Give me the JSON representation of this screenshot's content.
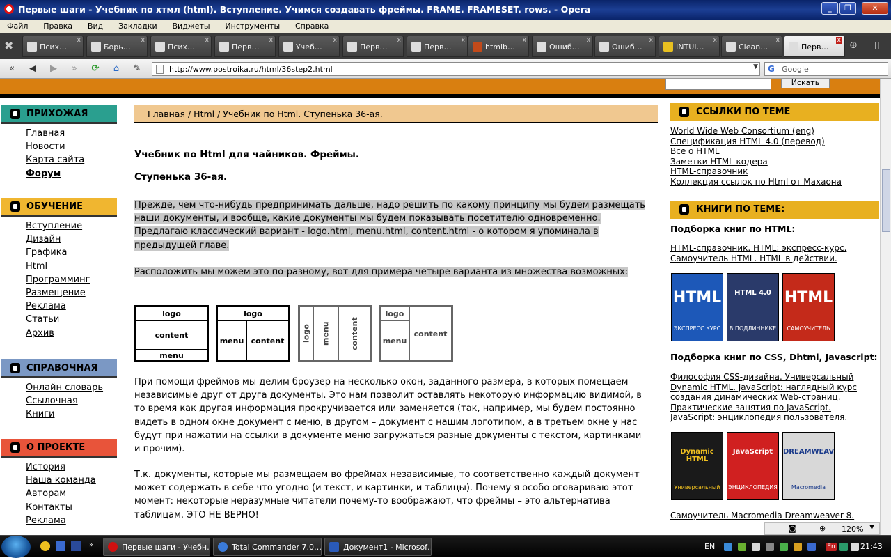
{
  "window": {
    "title": "Первые шаги - Учебник по хтмл (html). Вступление. Учимся создавать фреймы. FRAME. FRAMESET. rows. - Opera",
    "min": "_",
    "max": "❐",
    "close": "✕"
  },
  "menubar": [
    "Файл",
    "Правка",
    "Вид",
    "Закладки",
    "Виджеты",
    "Инструменты",
    "Справка"
  ],
  "tabs": [
    {
      "label": "Псих…",
      "close": "x"
    },
    {
      "label": "Борь…",
      "close": "x"
    },
    {
      "label": "Псих…",
      "close": "x"
    },
    {
      "label": "Перв…",
      "close": "x"
    },
    {
      "label": "Учеб…",
      "close": "x"
    },
    {
      "label": "Перв…",
      "close": "x"
    },
    {
      "label": "Перв…",
      "close": "x"
    },
    {
      "label": "htmlb…",
      "close": "x"
    },
    {
      "label": "Ошиб…",
      "close": "x"
    },
    {
      "label": "Ошиб…",
      "close": "x"
    },
    {
      "label": "INTUI…",
      "close": "x"
    },
    {
      "label": "Clean…",
      "close": "x"
    },
    {
      "label": "Перв…",
      "close": "x"
    }
  ],
  "address": {
    "url": "http://www.postroika.ru/html/36step2.html",
    "search_placeholder": "Google",
    "search_logo": "G"
  },
  "site": {
    "search_button": "Искать"
  },
  "sidebar": {
    "sections": [
      {
        "title": "ПРИХОЖАЯ",
        "color": "#2a9f8f",
        "items": [
          "Главная",
          "Новости",
          "Карта сайта",
          "Форум"
        ]
      },
      {
        "title": "ОБУЧЕНИЕ",
        "color": "#f0b630",
        "items": [
          "Вступление",
          "Дизайн",
          "Графика",
          "Html",
          "Программинг",
          "Размещение",
          "Реклама",
          "Статьи",
          "Архив"
        ]
      },
      {
        "title": "СПРАВОЧНАЯ",
        "color": "#7b98c4",
        "items": [
          "Онлайн словарь",
          "Ссылочная",
          "Книги"
        ]
      },
      {
        "title": "О ПРОЕКТЕ",
        "color": "#e8543a",
        "items": [
          "История",
          "Наша команда",
          "Авторам",
          "Контакты",
          "Реклама"
        ]
      }
    ]
  },
  "breadcrumb": {
    "home": "Главная",
    "sep1": " / ",
    "section": "Html",
    "sep2": " / ",
    "current": "Учебник по Html. Ступенька 36-ая."
  },
  "article": {
    "title": "Учебник по Html для чайников. Фреймы.",
    "subtitle": "Ступенька 36-ая.",
    "p1": "Прежде, чем что-нибудь предпринимать дальше, надо решить по какому принципу мы будем размещать наши документы, и вообще, какие документы мы будем показывать посетителю одновременно. Предлагаю классический вариант - logo.html, menu.html, content.html - о котором я упоминала в предыдущей главе.",
    "p2": "Расположить мы можем это по-разному, вот для примера четыре варианта из множества возможных:",
    "p3": "При помощи фреймов мы делим броузер на несколько окон, заданного размера, в которых помещаем независимые друг от друга документы. Это нам позволит оставлять некоторую информацию видимой, в то время как другая информация прокручивается или заменяется (так, например, мы будем постоянно видеть в одном окне документ с меню, в другом – документ с нашим логотипом, а в третьем окне у нас будут при нажатии на ссылки в документе меню загружаться разные документы с текстом, картинками и прочим).",
    "p4": "Т.к. документы, которые мы размещаем во фреймах независимые, то соответственно каждый документ может содержать в себе что угодно (и текст, и картинки, и таблицы). Почему я особо оговариваю этот момент: некоторые неразумные читатели почему-то воображают, что фреймы – это альтернатива таблицам. ЭТО НЕ ВЕРНО!",
    "frames": {
      "logo": "logo",
      "menu": "menu",
      "content": "content"
    }
  },
  "right": {
    "links_title": "ССЫЛКИ ПО ТЕМЕ",
    "links": [
      "World Wide Web Consortium (eng)",
      "Спецификация HTML 4.0 (перевод)",
      "Все о HTML",
      "Заметки HTML кодера",
      "HTML-справочник",
      "Коллекция ссылок по Html от Махаона"
    ],
    "books_title": "КНИГИ ПО ТЕМЕ:",
    "html_books_title": "Подборка книг по HTML:",
    "html_books": [
      "HTML-справочник. HTML: экспресс-курс.",
      "Самоучитель HTML. HTML в действии."
    ],
    "css_books_title": "Подборка книг по CSS, Dhtml, Javascript:",
    "css_books": [
      "Философия CSS-дизайна. Универсальный",
      "Dynamic HTML. JavaScript: наглядный курс",
      "создания динамических Web-страниц.",
      "Практические занятия по JavaScript.",
      "JavaScript: энциклопедия пользователя."
    ],
    "last_link": "Самоучитель Macromedia Dreamweaver 8.",
    "covers1": [
      {
        "title": "HTML",
        "sub": "ЭКСПРЕСС КУРС",
        "bg": "#1d58b8",
        "fg": "#fff"
      },
      {
        "title": "HTML 4.0",
        "sub": "В ПОДЛИННИКЕ",
        "bg": "#2a3a6a",
        "fg": "#fff"
      },
      {
        "title": "HTML",
        "sub": "САМОУЧИТЕЛЬ",
        "bg": "#c42a1a",
        "fg": "#fff"
      }
    ],
    "covers2": [
      {
        "title": "Dynamic HTML",
        "sub": "Универсальный",
        "bg": "#1a1a1a",
        "fg": "#f0c020"
      },
      {
        "title": "JavaScript",
        "sub": "ЭНЦИКЛОПЕДИЯ",
        "bg": "#d02020",
        "fg": "#fff"
      },
      {
        "title": "DREAMWEAVER",
        "sub": "Macromedia",
        "bg": "#d8d8d8",
        "fg": "#1a3a8a"
      }
    ]
  },
  "status": {
    "zoom": "120%"
  },
  "taskbar": {
    "windows": [
      "Первые шаги - Учебн…",
      "Total Commander 7.0…",
      "Документ1 - Microsof…"
    ],
    "lang": "EN",
    "lang2": "En",
    "clock": "21:43"
  }
}
